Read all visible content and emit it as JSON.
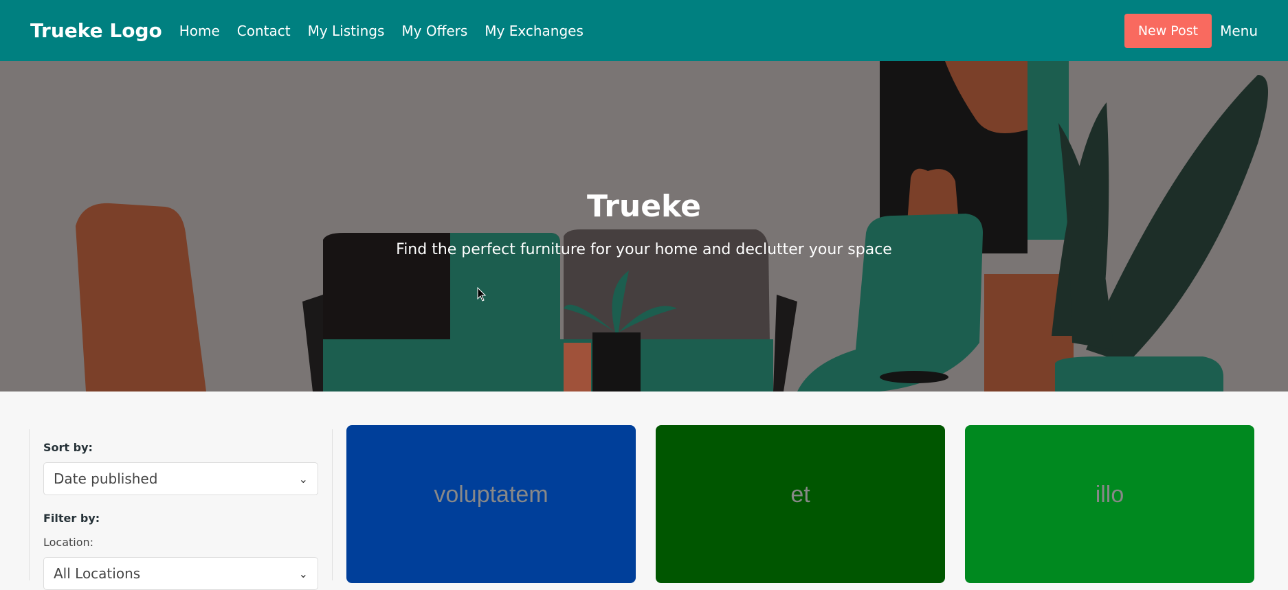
{
  "navbar": {
    "logo": "Trueke Logo",
    "links": [
      "Home",
      "Contact",
      "My Listings",
      "My Offers",
      "My Exchanges"
    ],
    "new_post_label": "New Post",
    "menu_label": "Menu"
  },
  "hero": {
    "title": "Trueke",
    "subtitle": "Find the perfect furniture for your home and declutter your space"
  },
  "sidebar": {
    "sort_label": "Sort by:",
    "sort_value": "Date published",
    "filter_label": "Filter by:",
    "location_label": "Location:",
    "location_value": "All Locations"
  },
  "listings": [
    {
      "title": "voluptatem",
      "color": "#003f9a"
    },
    {
      "title": "et",
      "color": "#005600"
    },
    {
      "title": "illo",
      "color": "#00891f"
    }
  ],
  "colors": {
    "brand": "#008080",
    "accent": "#f96a5f"
  }
}
